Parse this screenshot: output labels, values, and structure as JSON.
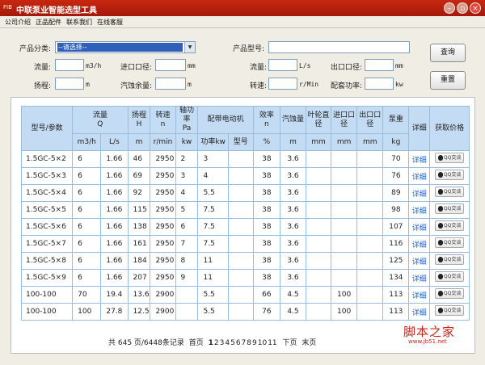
{
  "window": {
    "app_icon_text": "FIB",
    "title": "中联泵业智能选型工具",
    "controls": [
      "minimize",
      "maximize",
      "close"
    ]
  },
  "menu": [
    "公司介绍",
    "正品配件",
    "联系我们",
    "在线客服"
  ],
  "search": {
    "category_label": "产品分类:",
    "category_value": "--请选择--",
    "model_label": "产品型号:",
    "model_value": "",
    "flow_label": "流量:",
    "flow_unit": "m3/h",
    "inlet_label": "进口口径:",
    "inlet_unit": "mm",
    "flow2_label": "流量:",
    "flow2_unit": "L/s",
    "outlet_label": "出口口径:",
    "outlet_unit": "mm",
    "head_label": "扬程:",
    "head_unit": "m",
    "npsh_label": "汽蚀余量:",
    "npsh_unit": "m",
    "speed_label": "转速:",
    "speed_unit": "r/Min",
    "power_label": "配套功率:",
    "power_unit": "kw",
    "query_button": "查询",
    "reset_button": "重置"
  },
  "table": {
    "headers": {
      "model": "型号/参数",
      "flow": "流量",
      "flow_sym": "Q",
      "head": "扬程",
      "head_sym": "H",
      "speed": "转速",
      "speed_sym": "n",
      "shaft_power": "轴功率",
      "shaft_power_sym": "Pa",
      "motor": "配带电动机",
      "efficiency": "效率",
      "efficiency_sym": "n",
      "npsh": "汽蚀量",
      "impeller": "叶轮直径",
      "inlet": "进口口径",
      "outlet": "出口口径",
      "weight": "泵重",
      "detail": "详细",
      "price": "获取价格"
    },
    "units": {
      "flow_m3h": "m3/h",
      "flow_ls": "L/s",
      "head": "m",
      "speed": "r/min",
      "shaft_power": "kw",
      "motor_power": "功率kw",
      "motor_model": "型号",
      "efficiency": "%",
      "npsh": "m",
      "impeller": "mm",
      "inlet": "mm",
      "outlet": "mm",
      "weight": "kg"
    },
    "detail_link": "详细",
    "price_button": "QQ交谈",
    "rows": [
      {
        "model": "1.5GC-5×2",
        "flow_m3h": "6",
        "flow_ls": "1.66",
        "head": "46",
        "speed": "2950",
        "shaft_power": "2",
        "motor_power": "3",
        "motor_model": "",
        "efficiency": "38",
        "npsh": "3.6",
        "impeller": "",
        "inlet": "",
        "outlet": "",
        "weight": "70"
      },
      {
        "model": "1.5GC-5×3",
        "flow_m3h": "6",
        "flow_ls": "1.66",
        "head": "69",
        "speed": "2950",
        "shaft_power": "3",
        "motor_power": "4",
        "motor_model": "",
        "efficiency": "38",
        "npsh": "3.6",
        "impeller": "",
        "inlet": "",
        "outlet": "",
        "weight": "76"
      },
      {
        "model": "1.5GC-5×4",
        "flow_m3h": "6",
        "flow_ls": "1.66",
        "head": "92",
        "speed": "2950",
        "shaft_power": "4",
        "motor_power": "5.5",
        "motor_model": "",
        "efficiency": "38",
        "npsh": "3.6",
        "impeller": "",
        "inlet": "",
        "outlet": "",
        "weight": "89"
      },
      {
        "model": "1.5GC-5×5",
        "flow_m3h": "6",
        "flow_ls": "1.66",
        "head": "115",
        "speed": "2950",
        "shaft_power": "5",
        "motor_power": "7.5",
        "motor_model": "",
        "efficiency": "38",
        "npsh": "3.6",
        "impeller": "",
        "inlet": "",
        "outlet": "",
        "weight": "98"
      },
      {
        "model": "1.5GC-5×6",
        "flow_m3h": "6",
        "flow_ls": "1.66",
        "head": "138",
        "speed": "2950",
        "shaft_power": "6",
        "motor_power": "7.5",
        "motor_model": "",
        "efficiency": "38",
        "npsh": "3.6",
        "impeller": "",
        "inlet": "",
        "outlet": "",
        "weight": "107"
      },
      {
        "model": "1.5GC-5×7",
        "flow_m3h": "6",
        "flow_ls": "1.66",
        "head": "161",
        "speed": "2950",
        "shaft_power": "7",
        "motor_power": "7.5",
        "motor_model": "",
        "efficiency": "38",
        "npsh": "3.6",
        "impeller": "",
        "inlet": "",
        "outlet": "",
        "weight": "116"
      },
      {
        "model": "1.5GC-5×8",
        "flow_m3h": "6",
        "flow_ls": "1.66",
        "head": "184",
        "speed": "2950",
        "shaft_power": "8",
        "motor_power": "11",
        "motor_model": "",
        "efficiency": "38",
        "npsh": "3.6",
        "impeller": "",
        "inlet": "",
        "outlet": "",
        "weight": "125"
      },
      {
        "model": "1.5GC-5×9",
        "flow_m3h": "6",
        "flow_ls": "1.66",
        "head": "207",
        "speed": "2950",
        "shaft_power": "9",
        "motor_power": "11",
        "motor_model": "",
        "efficiency": "38",
        "npsh": "3.6",
        "impeller": "",
        "inlet": "",
        "outlet": "",
        "weight": "134"
      },
      {
        "model": "100-100",
        "flow_m3h": "70",
        "flow_ls": "19.4",
        "head": "13.6",
        "speed": "2900",
        "shaft_power": "",
        "motor_power": "5.5",
        "motor_model": "",
        "efficiency": "66",
        "npsh": "4.5",
        "impeller": "",
        "inlet": "100",
        "outlet": "",
        "weight": "113"
      },
      {
        "model": "100-100",
        "flow_m3h": "100",
        "flow_ls": "27.8",
        "head": "12.5",
        "speed": "2900",
        "shaft_power": "",
        "motor_power": "5.5",
        "motor_model": "",
        "efficiency": "76",
        "npsh": "4.5",
        "impeller": "",
        "inlet": "100",
        "outlet": "",
        "weight": "113"
      }
    ]
  },
  "pager": {
    "summary": "共 645 页/6448条记录",
    "first": "首页",
    "pages": [
      "1",
      "2",
      "3",
      "4",
      "5",
      "6",
      "7",
      "8",
      "9",
      "10",
      "11"
    ],
    "current": "1",
    "next": "下页",
    "last": "末页"
  },
  "watermark": {
    "text": "脚本之家",
    "url": "www.jb51.net"
  }
}
